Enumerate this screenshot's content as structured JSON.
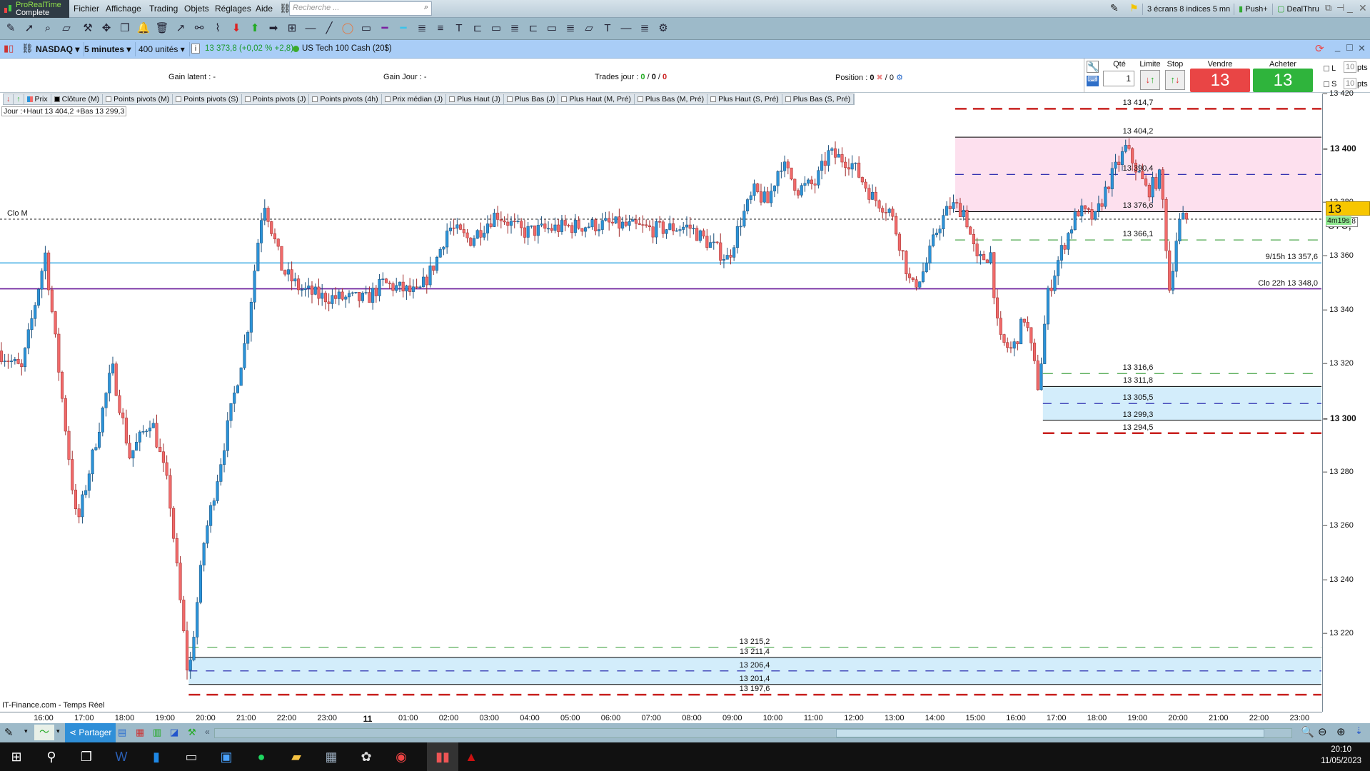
{
  "app": {
    "name": "ProRealTime",
    "edition": "Complete"
  },
  "menu": [
    "Fichier",
    "Affichage",
    "Trading",
    "Objets",
    "Réglages",
    "Aide"
  ],
  "search": {
    "placeholder": "Recherche ..."
  },
  "titlebar_right": {
    "layout": "3 écrans 8 indices 5 mn",
    "push": "Push+",
    "dealthru": "DealThru"
  },
  "toolbar_icons": [
    "pencil-icon",
    "cursor-icon",
    "zoom-icon",
    "ruler-icon",
    "tools-icon",
    "move-icon",
    "copy-icon",
    "alert-bell-icon",
    "trash-icon",
    "arrow-line-icon",
    "link-icon",
    "node-icon",
    "down-arrow-icon",
    "up-arrow-icon",
    "right-arrow-icon",
    "horizontal-zone-icon",
    "horizontal-line-icon",
    "trend-line-icon",
    "circle-icon",
    "rectangle-icon",
    "purple-line-icon",
    "cyan-line-icon",
    "fib-icon",
    "fib-levels-icon",
    "text-icon",
    "channel-icon",
    "box-icon",
    "fib-ext-icon",
    "channel2-icon",
    "box2-icon",
    "fib2-icon",
    "ruler2-icon",
    "text2-icon",
    "line2-icon",
    "fib3-icon",
    "settings-wheel-icon"
  ],
  "chart_header": {
    "instrument": "NASDAQ",
    "period": "5 minutes",
    "units": "400 unités",
    "quote": "13 373,8 (+0,02 % +2,8)",
    "name": "US Tech 100 Cash (20$)"
  },
  "trade_bar": {
    "gain_latent": "Gain latent : -",
    "gain_jour": "Gain Jour : -",
    "trades_label": "Trades jour : ",
    "trades_a": "0",
    "trades_b": "0",
    "trades_c": "0",
    "position_label": "Position : ",
    "position_val": "0",
    "position_total": "/ 0",
    "qty_label": "Qté",
    "qty_value": "1",
    "limit_label": "Limite",
    "stop_label": "Stop",
    "sell_label": "Vendre",
    "sell_price": "13 373,",
    "sell_dec": "3",
    "buy_label": "Acheter",
    "buy_price": "13 374,",
    "buy_dec": "3",
    "l_label": "L",
    "s_label": "S",
    "l_pts": "10",
    "s_pts": "10",
    "pts": "pts"
  },
  "indicator_tabs": [
    "Prix",
    "Clôture (M)",
    "Points pivots (M)",
    "Points pivots (S)",
    "Points pivots (J)",
    "Points pivots (4h)",
    "Prix médian (J)",
    "Plus Haut (J)",
    "Plus Bas (J)",
    "Plus Haut (M, Pré)",
    "Plus Bas (M, Pré)",
    "Plus Haut (S, Pré)",
    "Plus Bas (S, Pré)"
  ],
  "day_info": "Jour :+Haut 13 404,2 +Bas 13 299,3",
  "source": "IT-Finance.com - Temps Réel",
  "chart_data": {
    "type": "candlestick",
    "interval": "5 minutes",
    "ylim": [
      13198,
      13429
    ],
    "y_ticks": [
      {
        "v": 13420,
        "l": "13 420"
      },
      {
        "v": 13400,
        "l": "13 400",
        "bold": true
      },
      {
        "v": 13380,
        "l": "13 380"
      },
      {
        "v": 13360,
        "l": "13 360"
      },
      {
        "v": 13340,
        "l": "13 340"
      },
      {
        "v": 13320,
        "l": "13 320"
      },
      {
        "v": 13300,
        "l": "13 300",
        "bold": true
      },
      {
        "v": 13280,
        "l": "13 280"
      },
      {
        "v": 13260,
        "l": "13 260"
      },
      {
        "v": 13240,
        "l": "13 240"
      },
      {
        "v": 13220,
        "l": "13 220"
      }
    ],
    "x_ticks": [
      "16:00",
      "17:00",
      "18:00",
      "19:00",
      "20:00",
      "21:00",
      "22:00",
      "23:00",
      "11",
      "01:00",
      "02:00",
      "03:00",
      "04:00",
      "05:00",
      "06:00",
      "07:00",
      "08:00",
      "09:00",
      "10:00",
      "11:00",
      "12:00",
      "13:00",
      "14:00",
      "15:00",
      "16:00",
      "17:00",
      "18:00",
      "19:00",
      "20:00",
      "21:00",
      "22:00",
      "23:00"
    ],
    "price_path": [
      [
        "10 14:55",
        13325
      ],
      [
        "10 15:30",
        13318
      ],
      [
        "10 16:00",
        13355
      ],
      [
        "10 16:05",
        13361
      ],
      [
        "10 16:52",
        13260
      ],
      [
        "10 17:44",
        13319
      ],
      [
        "10 18:10",
        13286
      ],
      [
        "10 18:42",
        13300
      ],
      [
        "10 19:08",
        13273
      ],
      [
        "10 19:37",
        13203
      ],
      [
        "10 20:00",
        13254
      ],
      [
        "10 20:32",
        13293
      ],
      [
        "10 21:04",
        13332
      ],
      [
        "10 21:24",
        13374
      ],
      [
        "10 21:30",
        13380
      ],
      [
        "10 21:56",
        13355
      ],
      [
        "10 22:22",
        13348
      ],
      [
        "10 22:54",
        13345
      ],
      [
        "11 00:00",
        13344
      ],
      [
        "11 00:25",
        13350
      ],
      [
        "11 01:17",
        13346
      ],
      [
        "11 01:43",
        13358
      ],
      [
        "11 02:02",
        13371
      ],
      [
        "11 02:34",
        13366
      ],
      [
        "11 03:13",
        13376
      ],
      [
        "11 03:52",
        13369
      ],
      [
        "11 04:57",
        13371
      ],
      [
        "11 06:01",
        13372
      ],
      [
        "11 07:06",
        13370
      ],
      [
        "11 07:58",
        13371
      ],
      [
        "11 08:37",
        13363
      ],
      [
        "11 08:56",
        13359
      ],
      [
        "11 09:16",
        13374
      ],
      [
        "11 09:35",
        13384
      ],
      [
        "11 09:55",
        13380
      ],
      [
        "11 10:14",
        13395
      ],
      [
        "11 10:40",
        13385
      ],
      [
        "11 11:05",
        13387
      ],
      [
        "11 11:25",
        13398
      ],
      [
        "11 11:58",
        13395
      ],
      [
        "11 12:30",
        13382
      ],
      [
        "11 12:56",
        13377
      ],
      [
        "11 13:15",
        13361
      ],
      [
        "11 13:28",
        13348
      ],
      [
        "11 13:47",
        13355
      ],
      [
        "11 14:07",
        13371
      ],
      [
        "11 14:26",
        13379
      ],
      [
        "11 14:46",
        13377
      ],
      [
        "11 15:05",
        13358
      ],
      [
        "11 15:25",
        13361
      ],
      [
        "11 15:37",
        13329
      ],
      [
        "11 15:57",
        13325
      ],
      [
        "11 16:16",
        13338
      ],
      [
        "11 16:36",
        13311
      ],
      [
        "11 16:49",
        13345
      ],
      [
        "11 17:08",
        13361
      ],
      [
        "11 17:34",
        13377
      ],
      [
        "11 18:00",
        13374
      ],
      [
        "11 18:19",
        13387
      ],
      [
        "11 18:45",
        13400
      ],
      [
        "11 18:58",
        13394
      ],
      [
        "11 19:17",
        13384
      ],
      [
        "11 19:37",
        13390
      ],
      [
        "11 19:50",
        13348
      ],
      [
        "11 20:03",
        13372
      ],
      [
        "11 20:10",
        13373.8
      ]
    ],
    "last_price": "13 373,8",
    "last_price_tag": "13 373,",
    "last_price_dec": "8",
    "countdown": "4m19s",
    "countdown_under": ",8",
    "levels": [
      {
        "price": 13414.7,
        "label": "13 414,7",
        "style": "red-dash",
        "from": "11 14:30"
      },
      {
        "price": 13404.2,
        "label": "13 404,2",
        "style": "box-edge",
        "from": "11 14:30"
      },
      {
        "price": 13390.4,
        "label": "13 390,4",
        "style": "blue-dash",
        "from": "11 14:30"
      },
      {
        "price": 13376.6,
        "label": "13 376,6",
        "style": "box-edge",
        "from": "11 14:30"
      },
      {
        "price": 13373.8,
        "label": "Clo M",
        "style": "black-dot",
        "from": "10 14:55",
        "label_left": true
      },
      {
        "price": 13366.1,
        "label": "13 366,1",
        "style": "green-dash",
        "from": "11 14:30"
      },
      {
        "price": 13357.6,
        "label": "9/15h 13 357,6",
        "style": "cyan",
        "from": "10 14:55",
        "label_right": true
      },
      {
        "price": 13348.0,
        "label": "Clo 22h 13 348,0",
        "style": "purple",
        "from": "10 14:55",
        "label_right": true
      },
      {
        "price": 13316.6,
        "label": "13 316,6",
        "style": "green-dash",
        "from": "11 16:40"
      },
      {
        "price": 13311.8,
        "label": "13 311,8",
        "style": "box-edge",
        "from": "11 16:40"
      },
      {
        "price": 13305.5,
        "label": "13 305,5",
        "style": "blue-dash",
        "from": "11 16:40"
      },
      {
        "price": 13299.3,
        "label": "13 299,3",
        "style": "box-edge",
        "from": "11 16:40"
      },
      {
        "price": 13294.5,
        "label": "13 294,5",
        "style": "red-dash",
        "from": "11 16:40"
      },
      {
        "price": 13215.2,
        "label": "13 215,2",
        "style": "green-dash",
        "from": "10 19:35"
      },
      {
        "price": 13211.4,
        "label": "13 211,4",
        "style": "box-edge",
        "from": "10 19:35"
      },
      {
        "price": 13206.4,
        "label": "13 206,4",
        "style": "blue-dash",
        "from": "10 19:35"
      },
      {
        "price": 13201.4,
        "label": "13 201,4",
        "style": "box-edge",
        "from": "10 19:35"
      },
      {
        "price": 13197.6,
        "label": "13 197,6",
        "style": "red-dash",
        "from": "10 19:35"
      }
    ],
    "zones": [
      {
        "top": 13404.2,
        "bottom": 13376.6,
        "color": "#fde0ee",
        "from": "11 14:30"
      },
      {
        "top": 13311.8,
        "bottom": 13299.3,
        "color": "#d3edfb",
        "from": "11 16:40"
      },
      {
        "top": 13211.4,
        "bottom": 13201.4,
        "color": "#d3edfb",
        "from": "10 19:35"
      }
    ],
    "colors": {
      "up": "#2b93d8",
      "down": "#f06a6a",
      "up_wick": "#1c4f7a",
      "down_wick": "#a02a2a"
    }
  },
  "bottom_toolbar": {
    "share": "Partager"
  },
  "taskbar": {
    "icons": [
      "windows-start-icon",
      "search-icon",
      "task-view-icon",
      "word-icon",
      "app-icon",
      "printer-icon",
      "store-icon",
      "spotify-icon",
      "file-explorer-icon",
      "calculator-icon",
      "paint-icon",
      "chrome-icon",
      "prorealtime-icon",
      "acrobat-icon"
    ],
    "time": "20:10",
    "date": "11/05/2023"
  }
}
